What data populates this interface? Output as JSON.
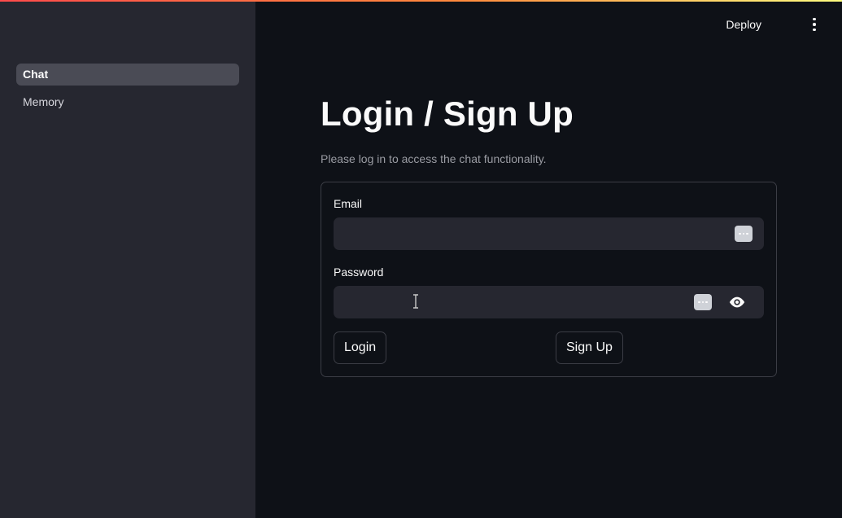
{
  "sidebar": {
    "items": [
      {
        "label": "Chat",
        "active": true
      },
      {
        "label": "Memory",
        "active": false
      }
    ]
  },
  "header": {
    "deploy_label": "Deploy",
    "menu_icon": "kebab-menu-icon"
  },
  "main": {
    "title": "Login / Sign Up",
    "subtitle": "Please log in to access the chat functionality."
  },
  "form": {
    "email_label": "Email",
    "email_value": "",
    "password_label": "Password",
    "password_value": "",
    "login_label": "Login",
    "signup_label": "Sign Up"
  },
  "colors": {
    "accent_gradient_start": "#ff4b4b",
    "accent_gradient_end": "#fffd80",
    "sidebar_bg": "#262730",
    "main_bg": "#0e1117"
  }
}
